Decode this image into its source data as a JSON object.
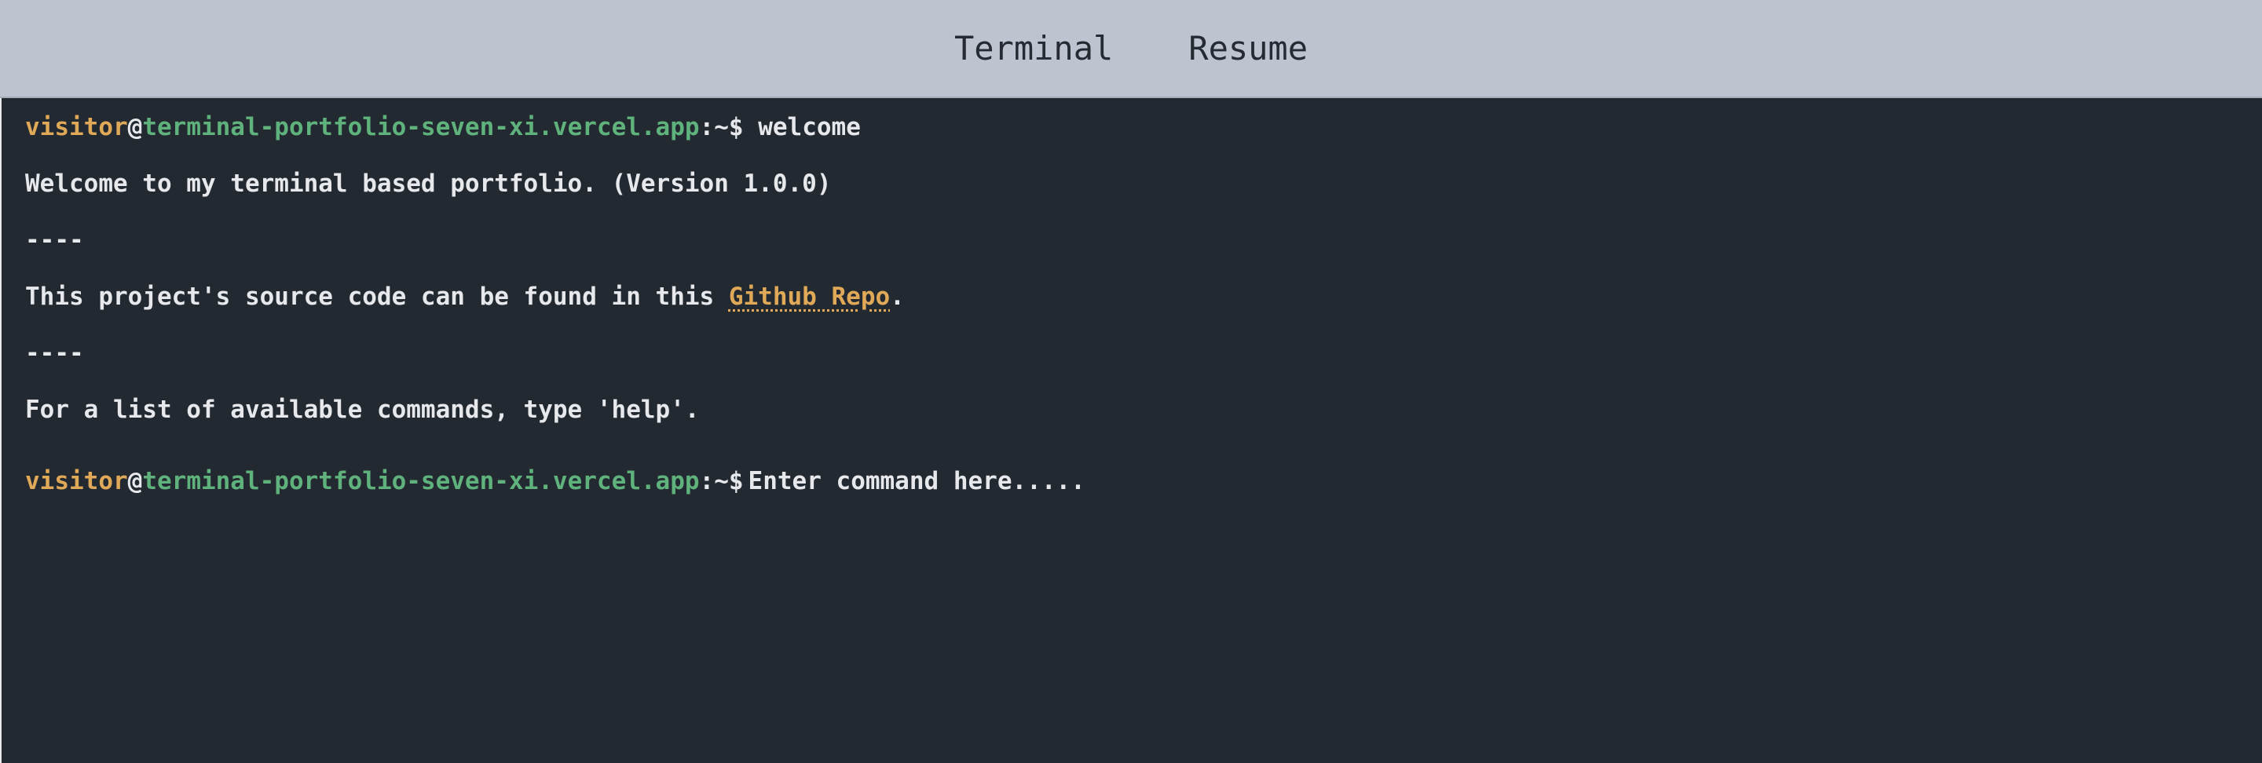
{
  "nav": {
    "tabs": [
      {
        "label": "Terminal"
      },
      {
        "label": "Resume"
      }
    ]
  },
  "prompt": {
    "user": "visitor",
    "at": "@",
    "host": "terminal-portfolio-seven-xi.vercel.app",
    "path": ":~$"
  },
  "history": {
    "command": "welcome",
    "welcome_line": "Welcome to my terminal based portfolio. (Version 1.0.0)",
    "divider": "----",
    "source_prefix": "This project's source code can be found in this ",
    "source_link": "Github Repo",
    "source_suffix": ".",
    "help_line": "For a list of available commands, type 'help'."
  },
  "input": {
    "placeholder": "Enter command here.....",
    "value": ""
  },
  "colors": {
    "background": "#232931",
    "header": "#bdc3cf",
    "user": "#e0a958",
    "host": "#5fb27c",
    "text": "#e6e8ec"
  }
}
